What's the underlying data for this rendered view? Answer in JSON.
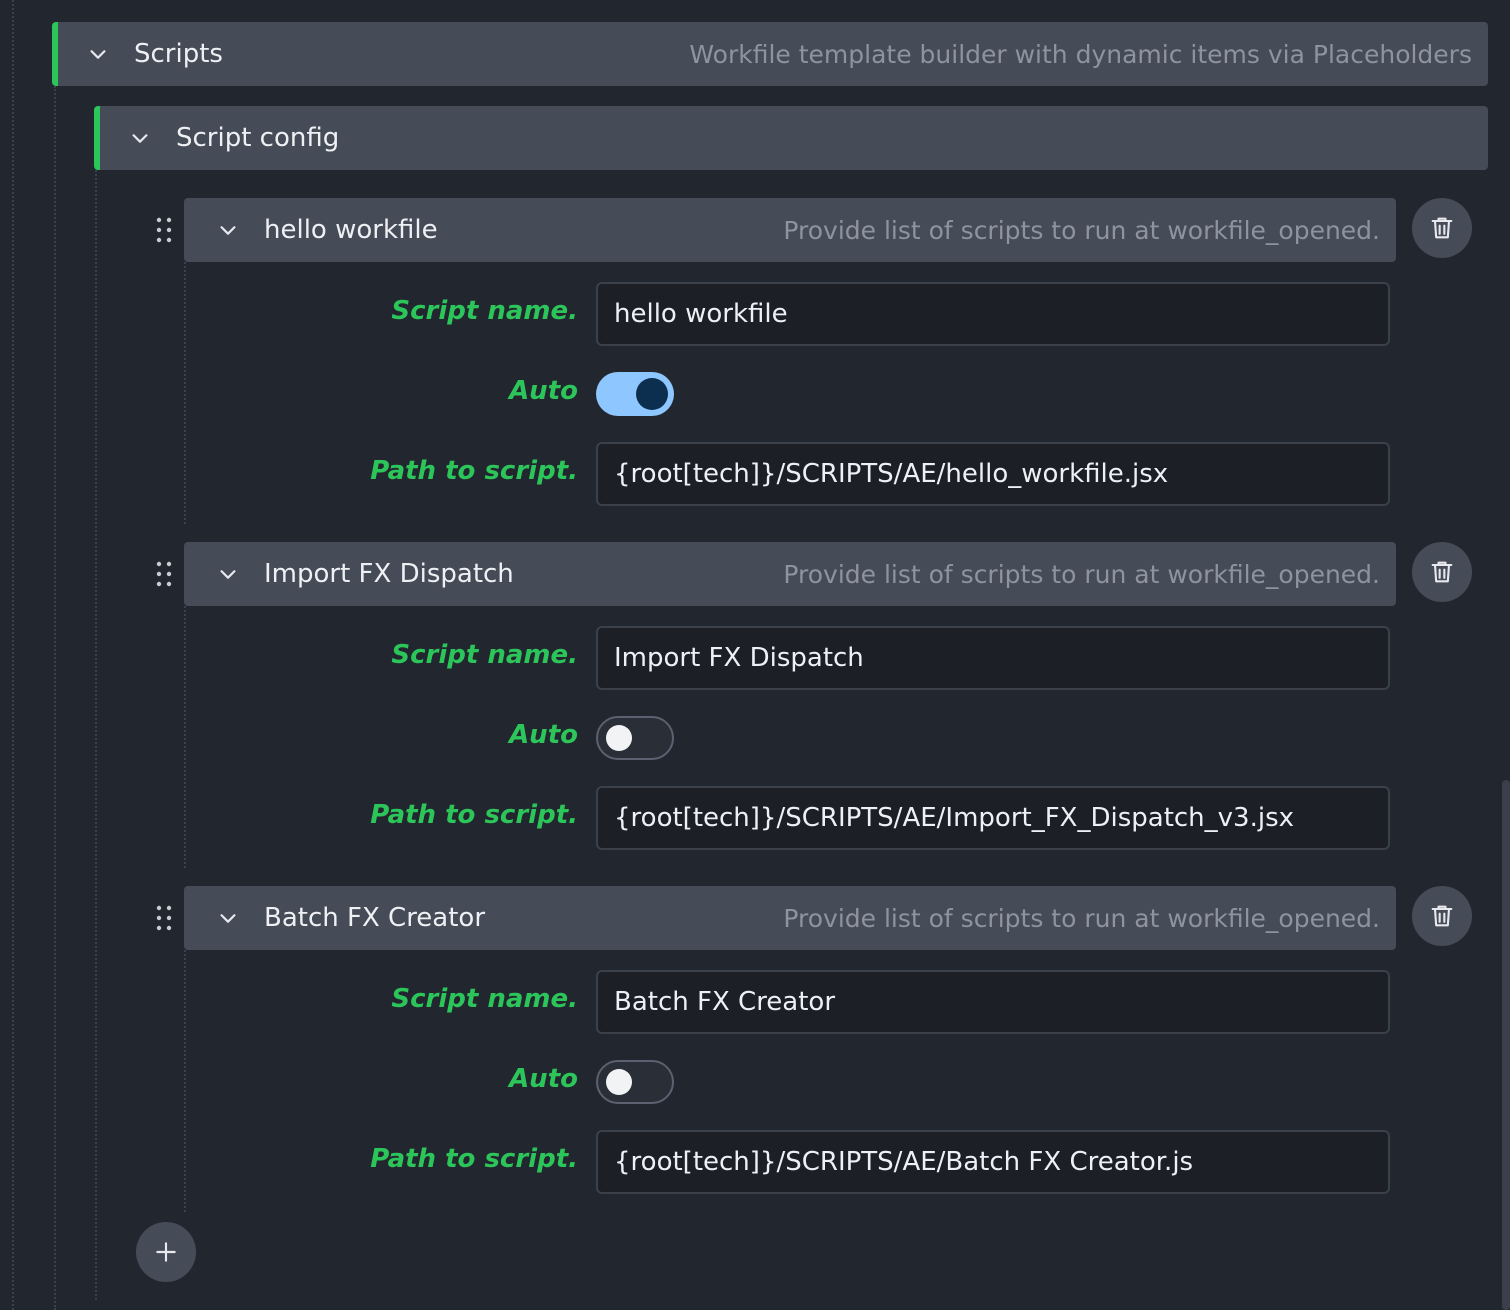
{
  "scripts_section": {
    "title": "Scripts",
    "description": "Workfile template builder with dynamic items via Placeholders"
  },
  "script_config": {
    "title": "Script config"
  },
  "labels": {
    "script_name": "Script name.",
    "auto": "Auto",
    "path": "Path to script."
  },
  "items": [
    {
      "title": "hello workfile",
      "description": "Provide list of scripts to run at workfile_opened.",
      "script_name": "hello workfile",
      "auto": true,
      "path": "{root[tech]}/SCRIPTS/AE/hello_workfile.jsx"
    },
    {
      "title": "Import FX Dispatch",
      "description": "Provide list of scripts to run at workfile_opened.",
      "script_name": "Import FX Dispatch",
      "auto": false,
      "path": "{root[tech]}/SCRIPTS/AE/Import_FX_Dispatch_v3.jsx"
    },
    {
      "title": "Batch FX Creator",
      "description": "Provide list of scripts to run at workfile_opened.",
      "script_name": "Batch FX Creator",
      "auto": false,
      "path": "{root[tech]}/SCRIPTS/AE/Batch FX Creator.js"
    }
  ],
  "colors": {
    "accent": "#2cc55a",
    "toggle_on": "#8ec7ff",
    "background": "#22262e",
    "header": "#454b57"
  },
  "icons": {
    "collapse": "chevron-down-icon",
    "drag": "drag-handle-icon",
    "delete": "trash-icon",
    "add": "plus-icon"
  }
}
